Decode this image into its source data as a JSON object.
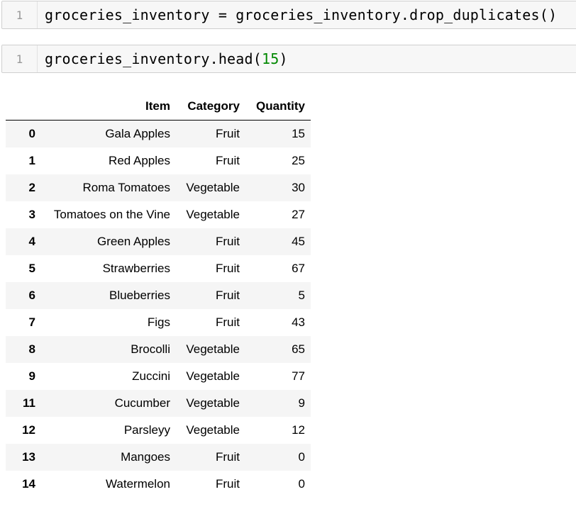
{
  "cells": [
    {
      "line_number": "1",
      "code_text": "groceries_inventory = groceries_inventory.drop_duplicates()"
    },
    {
      "line_number": "1",
      "code_prefix": "groceries_inventory.head(",
      "code_number": "15",
      "code_suffix": ")"
    }
  ],
  "table": {
    "columns": [
      "Item",
      "Category",
      "Quantity"
    ],
    "rows": [
      {
        "index": "0",
        "item": "Gala Apples",
        "category": "Fruit",
        "quantity": "15"
      },
      {
        "index": "1",
        "item": "Red Apples",
        "category": "Fruit",
        "quantity": "25"
      },
      {
        "index": "2",
        "item": "Roma Tomatoes",
        "category": "Vegetable",
        "quantity": "30"
      },
      {
        "index": "3",
        "item": "Tomatoes on the Vine",
        "category": "Vegetable",
        "quantity": "27"
      },
      {
        "index": "4",
        "item": "Green Apples",
        "category": "Fruit",
        "quantity": "45"
      },
      {
        "index": "5",
        "item": "Strawberries",
        "category": "Fruit",
        "quantity": "67"
      },
      {
        "index": "6",
        "item": "Blueberries",
        "category": "Fruit",
        "quantity": "5"
      },
      {
        "index": "7",
        "item": "Figs",
        "category": "Fruit",
        "quantity": "43"
      },
      {
        "index": "8",
        "item": "Brocolli",
        "category": "Vegetable",
        "quantity": "65"
      },
      {
        "index": "9",
        "item": "Zuccini",
        "category": "Vegetable",
        "quantity": "77"
      },
      {
        "index": "11",
        "item": "Cucumber",
        "category": "Vegetable",
        "quantity": "9"
      },
      {
        "index": "12",
        "item": "Parsleyy",
        "category": "Vegetable",
        "quantity": "12"
      },
      {
        "index": "13",
        "item": "Mangoes",
        "category": "Fruit",
        "quantity": "0"
      },
      {
        "index": "14",
        "item": "Watermelon",
        "category": "Fruit",
        "quantity": "0"
      }
    ]
  },
  "colors": {
    "cell_background": "#f7f7f7",
    "cell_border": "#cfcfcf",
    "line_number": "#999999",
    "number_literal": "#008800",
    "row_stripe": "#f5f5f5"
  }
}
